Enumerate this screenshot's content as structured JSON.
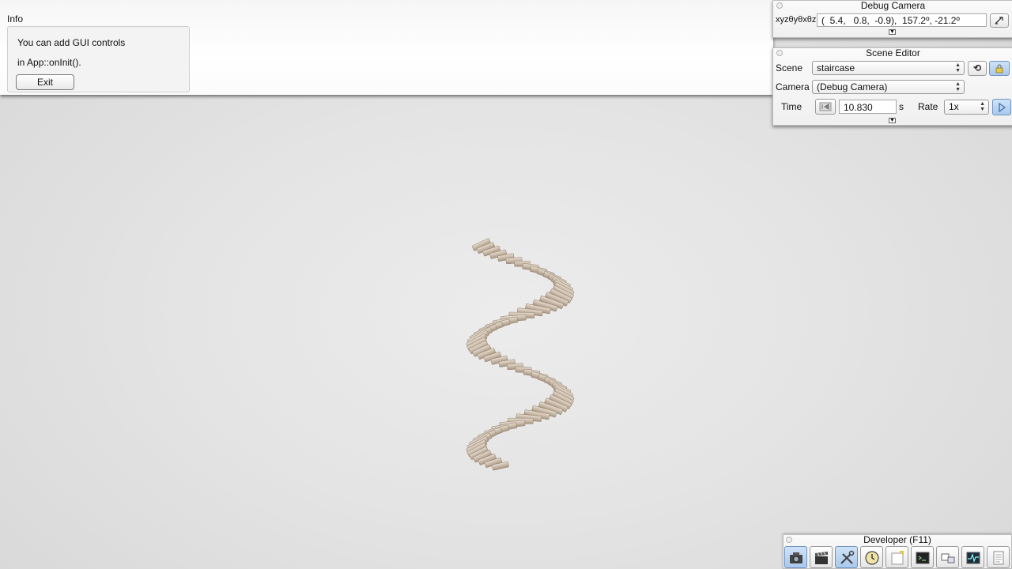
{
  "info": {
    "title": "Info",
    "line1": "You can add GUI controls",
    "line2": "in App::onInit().",
    "exit_label": "Exit"
  },
  "debug_camera": {
    "title": "Debug Camera",
    "xyz_label": "xyzθyθxθz",
    "value": "(  5.4,   0.8,  -0.9),  157.2º, -21.2º"
  },
  "scene_editor": {
    "title": "Scene Editor",
    "scene_label": "Scene",
    "scene_value": "staircase",
    "camera_label": "Camera",
    "camera_value": "(Debug Camera)",
    "time_label": "Time",
    "time_value": "10.830",
    "time_unit": "s",
    "rate_label": "Rate",
    "rate_value": "1x"
  },
  "developer": {
    "title": "Developer (F11)",
    "tools": [
      "camera-icon",
      "clapperboard-icon",
      "tools-icon",
      "clock-icon",
      "note-icon",
      "terminal-icon",
      "window-layout-icon",
      "profiler-icon",
      "document-icon"
    ]
  },
  "colors": {
    "accent": "#a9c9ec",
    "stair": "#cdbfae",
    "background": "#e4e4e4"
  }
}
